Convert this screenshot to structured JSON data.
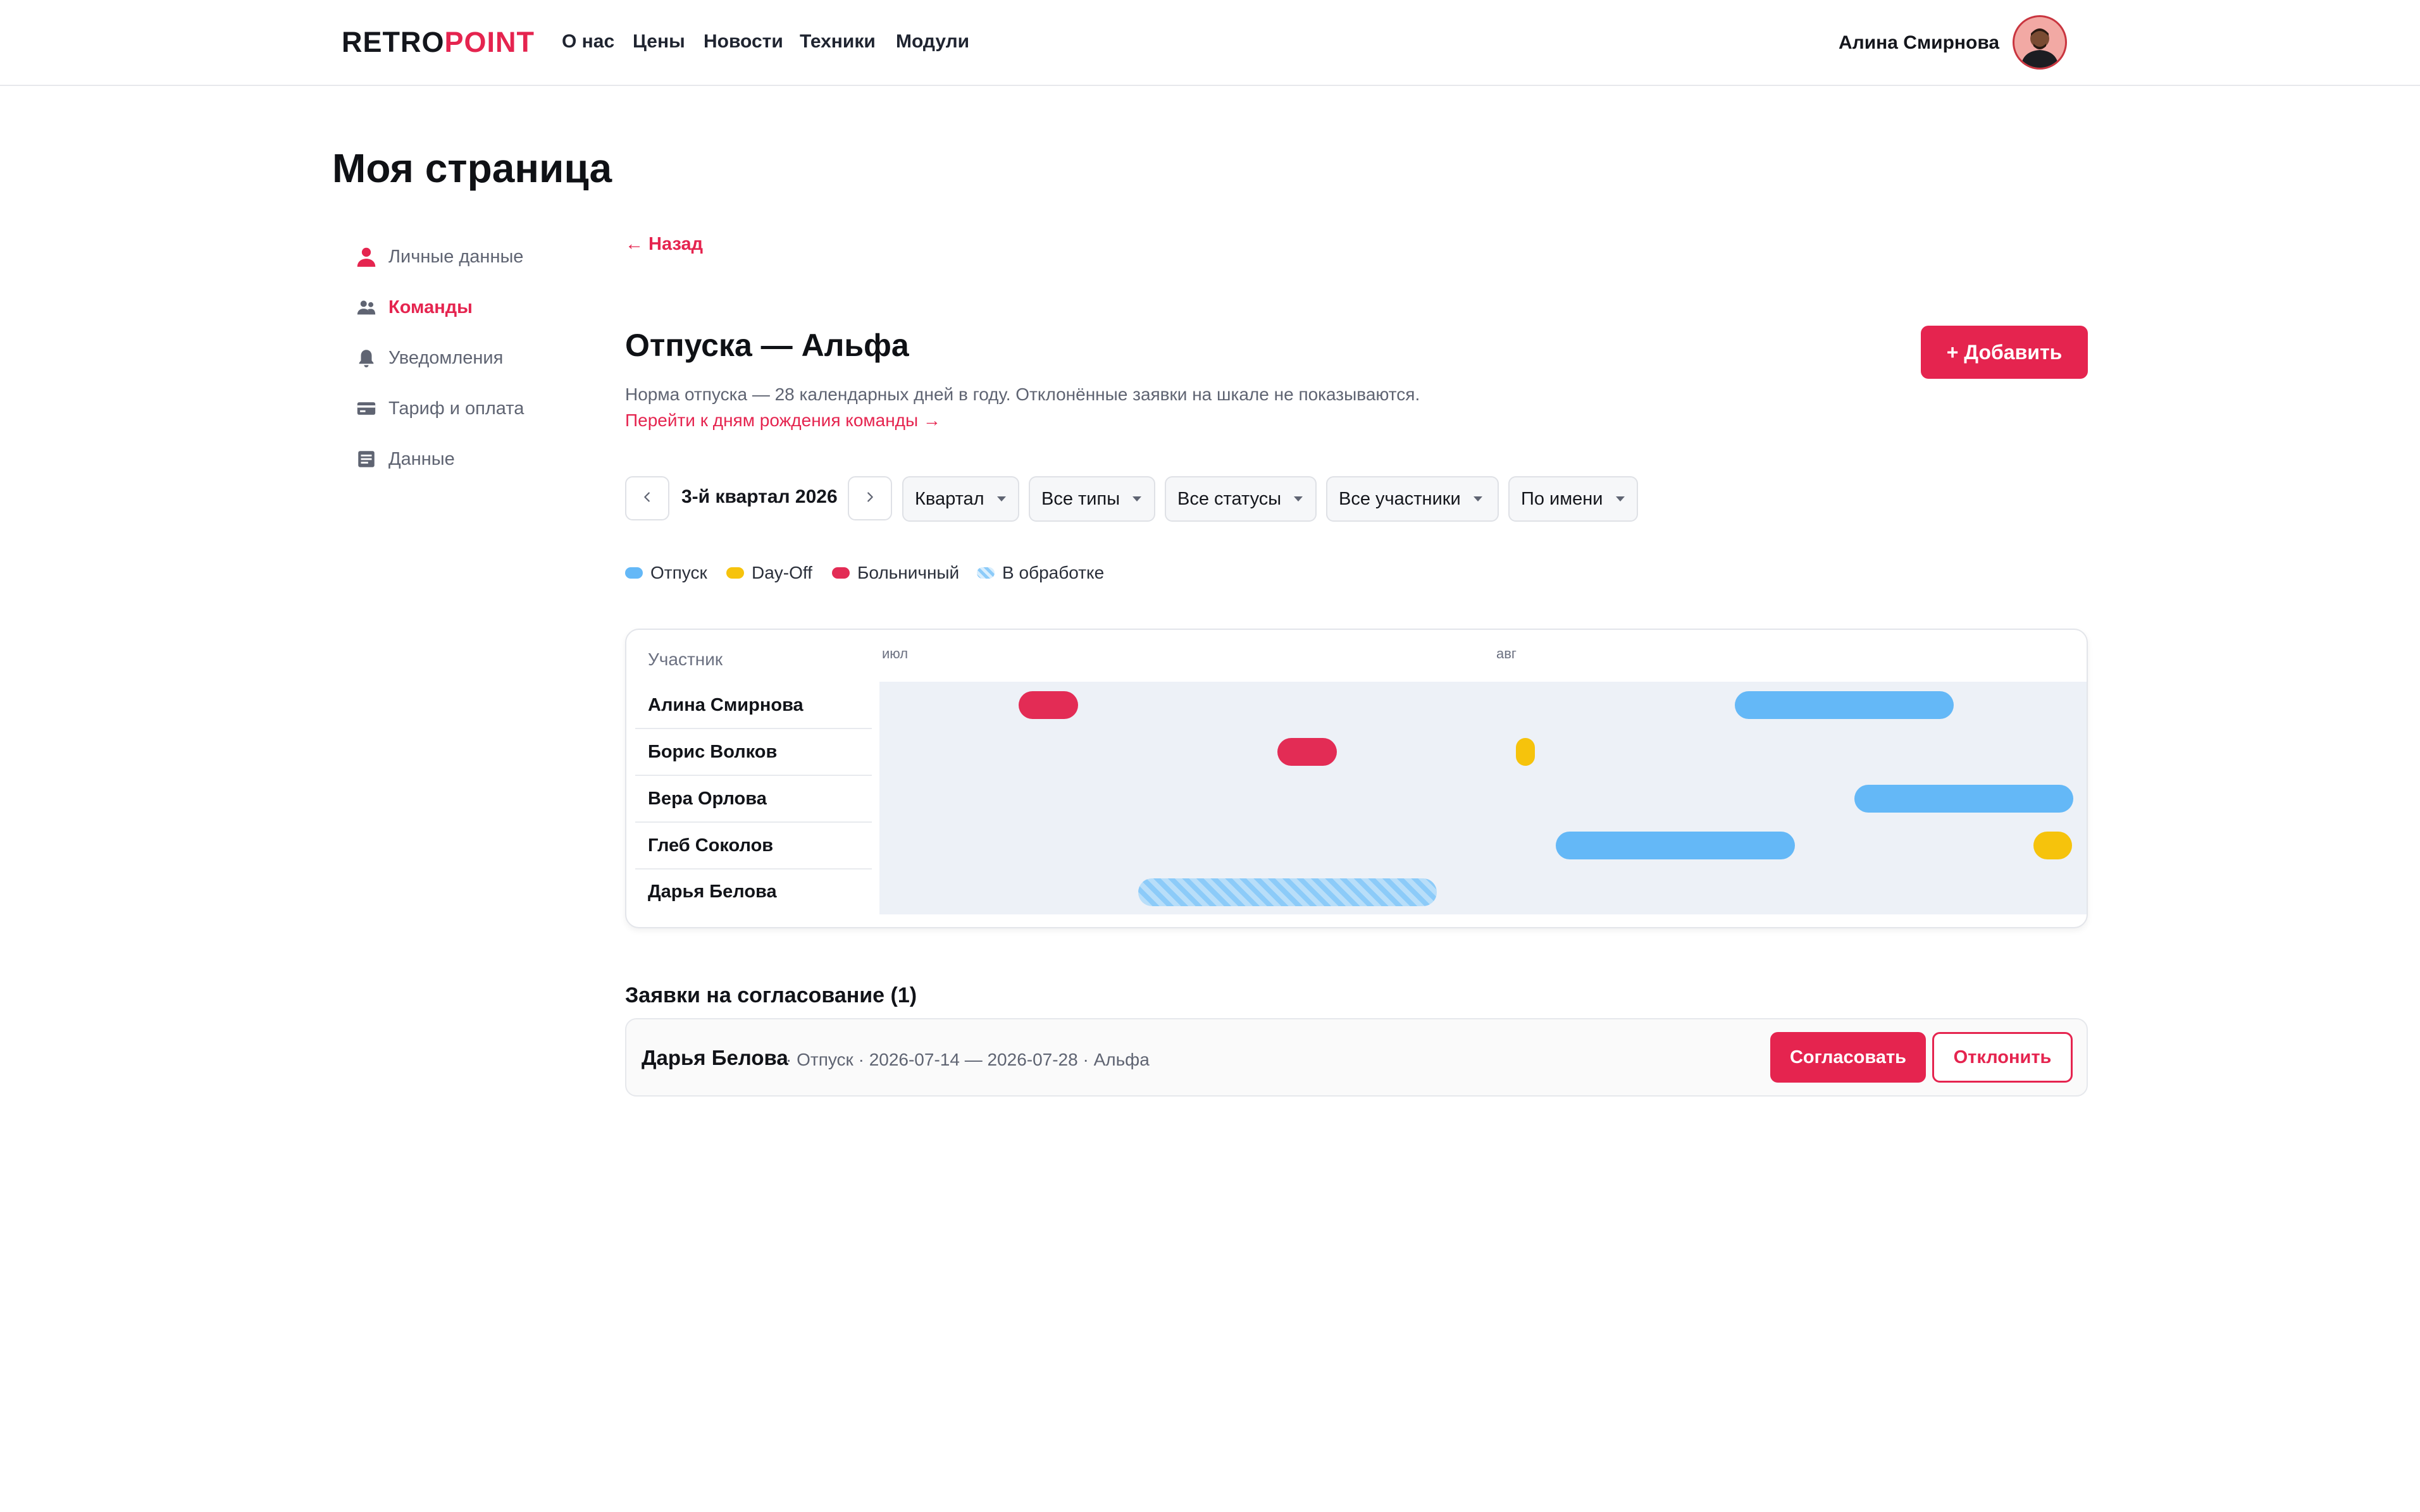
{
  "header": {
    "logo": {
      "part1": "RETRO",
      "part2": "POINT"
    },
    "nav": [
      "О нас",
      "Цены",
      "Новости",
      "Техники",
      "Модули"
    ],
    "user_name": "Алина Смирнова"
  },
  "page_title": "Моя страница",
  "sidebar": {
    "items": [
      {
        "label": "Личные данные",
        "icon": "person-icon",
        "active": false
      },
      {
        "label": "Команды",
        "icon": "team-icon",
        "active": true
      },
      {
        "label": "Уведомления",
        "icon": "bell-icon",
        "active": false
      },
      {
        "label": "Тариф и оплата",
        "icon": "card-icon",
        "active": false
      },
      {
        "label": "Данные",
        "icon": "document-icon",
        "active": false
      }
    ]
  },
  "main": {
    "back_label": "← Назад",
    "title": "Отпуска — Альфа",
    "add_label": "+ Добавить",
    "description": "Норма отпуска — 28 календарных дней в году. Отклонённые заявки на шкале не показываются.",
    "birthday_link": "Перейти к дням рождения команды →",
    "period_label": "3-й квартал 2026",
    "filters": [
      "Квартал",
      "Все типы",
      "Все статусы",
      "Все участники",
      "По имени"
    ],
    "legend": [
      {
        "label": "Отпуск",
        "color": "#64b8f7"
      },
      {
        "label": "Day-Off",
        "color": "#f6c30c"
      },
      {
        "label": "Больничный",
        "color": "#e32c55"
      },
      {
        "label": "В обработке",
        "color": "#8ccbf9"
      }
    ]
  },
  "timeline": {
    "participant_header": "Участник",
    "months": [
      "июл",
      "авг"
    ],
    "members": [
      {
        "name": "Алина Смирнова",
        "absences": [
          {
            "type": "sick",
            "from": "2026-07-08",
            "to": "2026-07-10"
          },
          {
            "type": "vacation",
            "from": "2026-08-13",
            "to": "2026-08-23"
          }
        ]
      },
      {
        "name": "Борис Волков",
        "absences": [
          {
            "type": "sick",
            "from": "2026-07-21",
            "to": "2026-07-23"
          },
          {
            "type": "dayoff",
            "from": "2026-08-02",
            "to": "2026-08-02"
          }
        ]
      },
      {
        "name": "Вера Орлова",
        "absences": [
          {
            "type": "vacation",
            "from": "2026-08-19",
            "to": "2026-08-29"
          }
        ]
      },
      {
        "name": "Глеб Соколов",
        "absences": [
          {
            "type": "vacation",
            "from": "2026-08-04",
            "to": "2026-08-15"
          },
          {
            "type": "dayoff",
            "from": "2026-08-28",
            "to": "2026-08-29"
          }
        ]
      },
      {
        "name": "Дарья Белова",
        "absences": [
          {
            "type": "pending",
            "from": "2026-07-14",
            "to": "2026-07-28"
          }
        ]
      }
    ]
  },
  "requests": {
    "title": "Заявки на согласование (1)",
    "items": [
      {
        "name": "Дарья Белова",
        "info": "· Отпуск · 2026-07-14 — 2026-07-28 · Альфа",
        "approve_label": "Согласовать",
        "reject_label": "Отклонить"
      }
    ]
  }
}
